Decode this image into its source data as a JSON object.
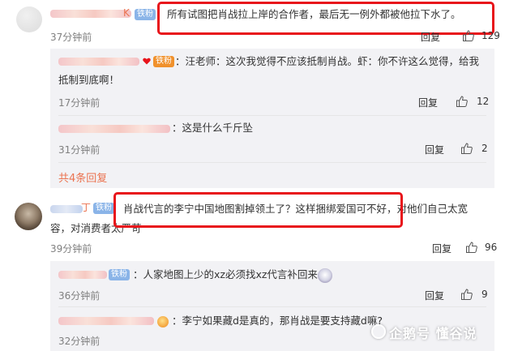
{
  "comments": [
    {
      "badge": "铁粉",
      "name_suffix": "K",
      "text": "所有试图把肖战拉上岸的合作者，最后无一例外都被他拉下水了。",
      "time": "37分钟前",
      "reply_label": "回复",
      "likes": "129",
      "replies": [
        {
          "badge": "铁粉",
          "text_line1": "：汪老师：这次我觉得不应该抵制肖战。虾：你不许这么觉得，给我",
          "text_line2": "抵制到底啊！",
          "time": "17分钟前",
          "reply_label": "回复",
          "likes": "12"
        },
        {
          "text": "：这是什么千斤坠",
          "time": "31分钟前",
          "reply_label": "回复",
          "likes": "2"
        }
      ],
      "more_replies": "共4条回复"
    },
    {
      "badge": "铁粉",
      "name_suffix": "丁",
      "text_line1": "肖战代言的李宁中国地图割掉领土了？这样捆绑爱国可不好，对他们自己太宽",
      "text_line2": "容，对消费者太严苛",
      "time": "39分钟前",
      "reply_label": "回复",
      "likes": "96",
      "replies": [
        {
          "badge": "铁粉",
          "text": "：人家地图上少的xz必须找xz代言补回来",
          "time": "36分钟前",
          "reply_label": "回复",
          "likes": "9"
        },
        {
          "text": "：李宁如果藏d是真的，那肖战是要支持藏d嘛?",
          "time": "32分钟前",
          "reply_label": "回复",
          "likes": "2"
        }
      ]
    }
  ],
  "watermark": "企鹅号 懂谷说",
  "colors": {
    "highlight": "#e8141b",
    "badge": "#8ab4e8",
    "link": "#eb7350"
  }
}
